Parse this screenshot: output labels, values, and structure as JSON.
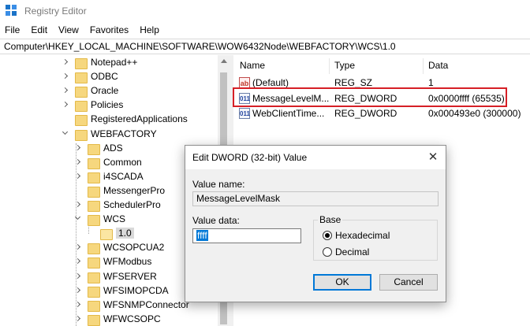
{
  "window": {
    "title": "Registry Editor"
  },
  "menu": [
    "File",
    "Edit",
    "View",
    "Favorites",
    "Help"
  ],
  "address": "Computer\\HKEY_LOCAL_MACHINE\\SOFTWARE\\WOW6432Node\\WEBFACTORY\\WCS\\1.0",
  "tree": [
    {
      "label": "Notepad++",
      "state": "collapsed",
      "level": 0
    },
    {
      "label": "ODBC",
      "state": "collapsed",
      "level": 0
    },
    {
      "label": "Oracle",
      "state": "collapsed",
      "level": 0
    },
    {
      "label": "Policies",
      "state": "collapsed",
      "level": 0
    },
    {
      "label": "RegisteredApplications",
      "state": "leaf",
      "level": 0
    },
    {
      "label": "WEBFACTORY",
      "state": "expanded",
      "level": 0
    },
    {
      "label": "ADS",
      "state": "collapsed",
      "level": 1
    },
    {
      "label": "Common",
      "state": "collapsed",
      "level": 1
    },
    {
      "label": "i4SCADA",
      "state": "collapsed",
      "level": 1
    },
    {
      "label": "MessengerPro",
      "state": "leaf",
      "level": 1
    },
    {
      "label": "SchedulerPro",
      "state": "collapsed",
      "level": 1
    },
    {
      "label": "WCS",
      "state": "expanded",
      "level": 1
    },
    {
      "label": "1.0",
      "state": "selected",
      "level": 2
    },
    {
      "label": "WCSOPCUA2",
      "state": "collapsed",
      "level": 1
    },
    {
      "label": "WFModbus",
      "state": "collapsed",
      "level": 1
    },
    {
      "label": "WFSERVER",
      "state": "collapsed",
      "level": 1
    },
    {
      "label": "WFSIMOPCDA",
      "state": "collapsed",
      "level": 1
    },
    {
      "label": "WFSNMPConnector",
      "state": "collapsed",
      "level": 1
    },
    {
      "label": "WFWCSOPC",
      "state": "collapsed",
      "level": 1
    }
  ],
  "values_pane": {
    "columns": {
      "name": "Name",
      "type": "Type",
      "data": "Data"
    },
    "rows": [
      {
        "icon": "ab",
        "name": "(Default)",
        "type": "REG_SZ",
        "data": "1"
      },
      {
        "icon": "dword",
        "name": "MessageLevelM...",
        "type": "REG_DWORD",
        "data": "0x0000ffff (65535)"
      },
      {
        "icon": "dword",
        "name": "WebClientTime...",
        "type": "REG_DWORD",
        "data": "0x000493e0 (300000)"
      }
    ],
    "icon_glyphs": {
      "ab": "ab",
      "dword": "011"
    }
  },
  "dialog": {
    "title": "Edit DWORD (32-bit) Value",
    "value_name_label": "Value name:",
    "value_name": "MessageLevelMask",
    "value_data_label": "Value data:",
    "value_data": "ffff",
    "base_label": "Base",
    "hex_label": "Hexadecimal",
    "dec_label": "Decimal",
    "ok_label": "OK",
    "cancel_label": "Cancel",
    "close_glyph": "✕"
  },
  "colors": {
    "highlight": "#d61f26",
    "accent": "#0078d7",
    "folder": "#f6d77e"
  }
}
